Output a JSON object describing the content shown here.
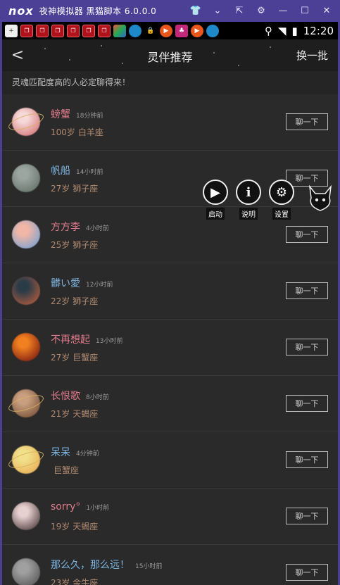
{
  "emulator": {
    "logo": "nox",
    "title": "夜神模拟器 黑猫脚本 6.0.0.0",
    "controls": [
      "👕",
      "⌄",
      "⇱",
      "⚙",
      "—",
      "☐",
      "✕"
    ]
  },
  "statusbar": {
    "time": "12:20",
    "icons": [
      "plus-icon",
      "notify-icon",
      "notify-icon",
      "notify-icon",
      "notify-icon",
      "notify-icon",
      "notify-icon",
      "app-icon",
      "app-icon",
      "lock-icon",
      "record-icon",
      "game-icon",
      "record-icon",
      "app-icon"
    ]
  },
  "header": {
    "back": "<",
    "title": "灵伴推荐",
    "refresh": "换一批",
    "subtitle": "灵魂匹配度高的人必定聊得来！"
  },
  "overlay": {
    "start": "启动",
    "help": "说明",
    "settings": "设置"
  },
  "chat_label": "聊一下",
  "users": [
    {
      "name": "螃蟹",
      "time": "18分钟前",
      "age": "100岁",
      "sign": "白羊座",
      "name_color": "#e07a8a",
      "avatar": [
        "#f5d8d8",
        "#d26a6a"
      ],
      "ring": true
    },
    {
      "name": "帆船",
      "time": "14小时前",
      "age": "27岁",
      "sign": "狮子座",
      "name_color": "#7cb4e0",
      "avatar": [
        "#9ba6a0",
        "#5d6a62"
      ],
      "ring": false
    },
    {
      "name": "方方李",
      "time": "4小时前",
      "age": "25岁",
      "sign": "狮子座",
      "name_color": "#e07a8a",
      "avatar": [
        "#f2b6a6",
        "#6aa0d8"
      ],
      "ring": false
    },
    {
      "name": "髒い愛",
      "time": "12小时前",
      "age": "22岁",
      "sign": "狮子座",
      "name_color": "#7cb4e0",
      "avatar": [
        "#2a3b48",
        "#c2603e"
      ],
      "ring": false
    },
    {
      "name": "不再想起",
      "time": "13小时前",
      "age": "27岁",
      "sign": "巨蟹座",
      "name_color": "#e07a8a",
      "avatar": [
        "#f08020",
        "#701010"
      ],
      "ring": false
    },
    {
      "name": "长恨歌",
      "time": "8小时前",
      "age": "21岁",
      "sign": "天蝎座",
      "name_color": "#e07a8a",
      "avatar": [
        "#c8a080",
        "#704830"
      ],
      "ring": true
    },
    {
      "name": "呆呆",
      "time": "4分钟前",
      "age": "",
      "sign": "巨蟹座",
      "name_color": "#7cb4e0",
      "avatar": [
        "#f0e08a",
        "#e8a850"
      ],
      "ring": true
    },
    {
      "name": "sorry°",
      "time": "1小时前",
      "age": "19岁",
      "sign": "天蝎座",
      "name_color": "#e07a8a",
      "avatar": [
        "#e8d0d0",
        "#403030"
      ],
      "ring": false
    },
    {
      "name": "那么久，那么远！",
      "time": "15小时前",
      "age": "23岁",
      "sign": "金牛座",
      "name_color": "#7cb4e0",
      "avatar": [
        "#a0a0a0",
        "#505050"
      ],
      "ring": false
    }
  ]
}
